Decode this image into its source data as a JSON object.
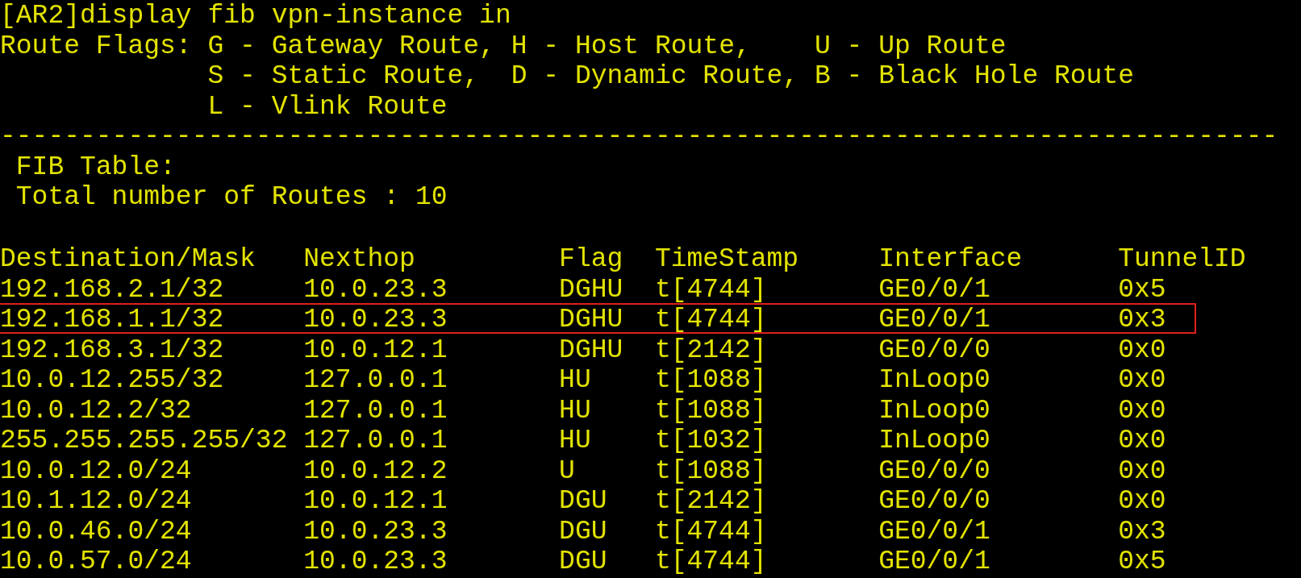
{
  "command": "[AR2]display fib vpn-instance in",
  "legend": {
    "label": "Route Flags:",
    "lines": [
      "G - Gateway Route, H - Host Route,    U - Up Route",
      "S - Static Route,  D - Dynamic Route, B - Black Hole Route",
      "L - Vlink Route"
    ]
  },
  "separator": "--------------------------------------------------------------------------------",
  "table_title": "FIB Table:",
  "total": "Total number of Routes : 10",
  "table": {
    "columns": [
      "Destination/Mask",
      "Nexthop",
      "Flag",
      "TimeStamp",
      "Interface",
      "TunnelID"
    ],
    "rows": [
      {
        "cells": [
          "192.168.2.1/32",
          "10.0.23.3",
          "DGHU",
          "t[4744]",
          "GE0/0/1",
          "0x5"
        ],
        "highlighted": false
      },
      {
        "cells": [
          "192.168.1.1/32",
          "10.0.23.3",
          "DGHU",
          "t[4744]",
          "GE0/0/1",
          "0x3"
        ],
        "highlighted": true
      },
      {
        "cells": [
          "192.168.3.1/32",
          "10.0.12.1",
          "DGHU",
          "t[2142]",
          "GE0/0/0",
          "0x0"
        ],
        "highlighted": false
      },
      {
        "cells": [
          "10.0.12.255/32",
          "127.0.0.1",
          "HU",
          "t[1088]",
          "InLoop0",
          "0x0"
        ],
        "highlighted": false
      },
      {
        "cells": [
          "10.0.12.2/32",
          "127.0.0.1",
          "HU",
          "t[1088]",
          "InLoop0",
          "0x0"
        ],
        "highlighted": false
      },
      {
        "cells": [
          "255.255.255.255/32",
          "127.0.0.1",
          "HU",
          "t[1032]",
          "InLoop0",
          "0x0"
        ],
        "highlighted": false
      },
      {
        "cells": [
          "10.0.12.0/24",
          "10.0.12.2",
          "U",
          "t[1088]",
          "GE0/0/0",
          "0x0"
        ],
        "highlighted": false
      },
      {
        "cells": [
          "10.1.12.0/24",
          "10.0.12.1",
          "DGU",
          "t[2142]",
          "GE0/0/0",
          "0x0"
        ],
        "highlighted": false
      },
      {
        "cells": [
          "10.0.46.0/24",
          "10.0.23.3",
          "DGU",
          "t[4744]",
          "GE0/0/1",
          "0x3"
        ],
        "highlighted": false
      },
      {
        "cells": [
          "10.0.57.0/24",
          "10.0.23.3",
          "DGU",
          "t[4744]",
          "GE0/0/1",
          "0x5"
        ],
        "highlighted": false
      }
    ]
  }
}
